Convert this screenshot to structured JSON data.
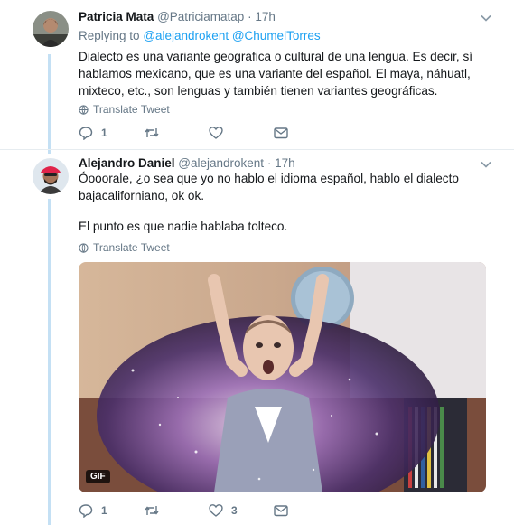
{
  "tweets": [
    {
      "name": "Patricia Mata",
      "handle": "@Patriciamatap",
      "separator": "·",
      "time": "17h",
      "reply_prefix": "Replying to",
      "mentions": [
        "@alejandrokent",
        "@ChumelTorres"
      ],
      "text": "Dialecto es una variante geografica o cultural de una lengua. Es decir, sí hablamos mexicano, que es una variante del español. El maya, náhuatl, mixteco, etc., son lenguas y también tienen variantes geográficas.",
      "translate": "Translate Tweet",
      "reply_count": "1",
      "retweet_count": "",
      "like_count": ""
    },
    {
      "name": "Alejandro Daniel",
      "handle": "@alejandrokent",
      "separator": "·",
      "time": "17h",
      "text_1": "Óooorale, ¿o sea que yo no hablo el idioma español, hablo el dialecto bajacaliforniano, ok ok.",
      "text_2": "El punto es que nadie hablaba tolteco.",
      "translate": "Translate Tweet",
      "gif_label": "GIF",
      "reply_count": "1",
      "retweet_count": "",
      "like_count": "3"
    }
  ],
  "colors": {
    "link": "#1da1f2",
    "muted": "#657786",
    "thread": "#c4e0f4"
  },
  "icons": [
    "chevron-down-icon",
    "globe-icon",
    "reply-icon",
    "retweet-icon",
    "like-icon",
    "dm-icon"
  ]
}
